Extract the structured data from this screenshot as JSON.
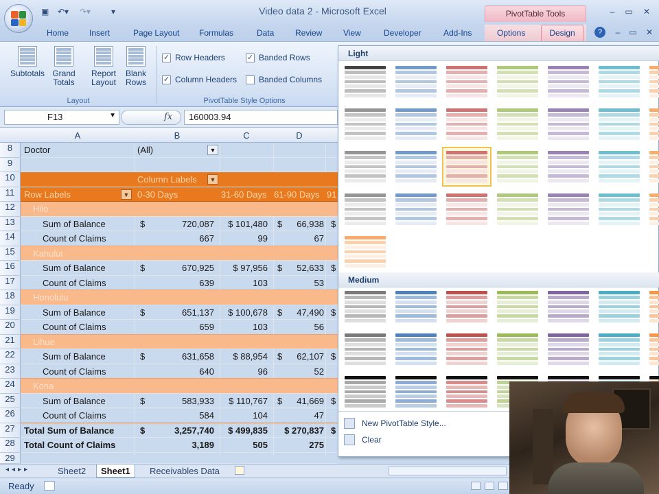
{
  "window": {
    "title": "Video data 2 - Microsoft Excel",
    "contextual_tab_group": "PivotTable Tools"
  },
  "tabs": [
    "Home",
    "Insert",
    "Page Layout",
    "Formulas",
    "Data",
    "Review",
    "View",
    "Developer",
    "Add-Ins",
    "Options",
    "Design"
  ],
  "ribbon": {
    "layout_group": {
      "label": "Layout",
      "buttons": [
        "Subtotals",
        "Grand Totals",
        "Report Layout",
        "Blank Rows"
      ]
    },
    "style_options_group": {
      "label": "PivotTable Style Options",
      "checkboxes": [
        {
          "label": "Row Headers",
          "checked": true
        },
        {
          "label": "Banded Rows",
          "checked": true
        },
        {
          "label": "Column Headers",
          "checked": true
        },
        {
          "label": "Banded Columns",
          "checked": false
        }
      ]
    }
  },
  "formula_bar": {
    "name_box": "F13",
    "fx": "fx",
    "formula": "160003.94"
  },
  "columns": [
    "A",
    "B",
    "C",
    "D"
  ],
  "rows": {
    "r8": {
      "num": "8",
      "a": "Doctor",
      "b": "(All)"
    },
    "r9": {
      "num": "9"
    },
    "r10": {
      "num": "10",
      "b": "Column Labels"
    },
    "r11": {
      "num": "11",
      "a": "Row Labels",
      "b": "0-30 Days",
      "c": "31-60 Days",
      "d": "61-90 Days",
      "e": "91"
    },
    "r12": {
      "num": "12",
      "a": "Hilo"
    },
    "r13": {
      "num": "13",
      "a": "Sum of Balance",
      "b_sym": "$",
      "b": "720,087",
      "c": "$ 101,480",
      "d_sym": "$",
      "d": "66,938",
      "e": "$"
    },
    "r14": {
      "num": "14",
      "a": "Count of Claims",
      "b": "667",
      "c": "99",
      "d": "67"
    },
    "r15": {
      "num": "15",
      "a": "Kahului"
    },
    "r16": {
      "num": "16",
      "a": "Sum of Balance",
      "b_sym": "$",
      "b": "670,925",
      "c": "$ 97,956",
      "d_sym": "$",
      "d": "52,633",
      "e": "$"
    },
    "r17": {
      "num": "17",
      "a": "Count of Claims",
      "b": "639",
      "c": "103",
      "d": "53"
    },
    "r18": {
      "num": "18",
      "a": "Honolulu"
    },
    "r19": {
      "num": "19",
      "a": "Sum of Balance",
      "b_sym": "$",
      "b": "651,137",
      "c": "$ 100,678",
      "d_sym": "$",
      "d": "47,490",
      "e": "$"
    },
    "r20": {
      "num": "20",
      "a": "Count of Claims",
      "b": "659",
      "c": "103",
      "d": "56"
    },
    "r21": {
      "num": "21",
      "a": "Lihue"
    },
    "r22": {
      "num": "22",
      "a": "Sum of Balance",
      "b_sym": "$",
      "b": "631,658",
      "c": "$ 88,954",
      "d_sym": "$",
      "d": "62,107",
      "e": "$"
    },
    "r23": {
      "num": "23",
      "a": "Count of Claims",
      "b": "640",
      "c": "96",
      "d": "52"
    },
    "r24": {
      "num": "24",
      "a": "Kona"
    },
    "r25": {
      "num": "25",
      "a": "Sum of Balance",
      "b_sym": "$",
      "b": "583,933",
      "c": "$ 110,767",
      "d_sym": "$",
      "d": "41,669",
      "e": "$"
    },
    "r26": {
      "num": "26",
      "a": "Count of Claims",
      "b": "584",
      "c": "104",
      "d": "47"
    },
    "r27": {
      "num": "27",
      "a": "Total Sum of Balance",
      "b_sym": "$",
      "b": "3,257,740",
      "c": "$ 499,835",
      "d": "$ 270,837",
      "e": "$"
    },
    "r28": {
      "num": "28",
      "a": "Total Count of Claims",
      "b": "3,189",
      "c": "505",
      "d": "275"
    },
    "r29": {
      "num": "29"
    }
  },
  "sheet_tabs": [
    "Sheet2",
    "Sheet1",
    "Receivables Data"
  ],
  "active_sheet": "Sheet1",
  "status": "Ready",
  "gallery": {
    "light_label": "Light",
    "medium_label": "Medium",
    "menu": [
      "New PivotTable Style...",
      "Clear"
    ],
    "palette": [
      "#7a7a7a",
      "#4f81bd",
      "#c0504d",
      "#9bbb59",
      "#8064a2",
      "#4bacc6",
      "#f79646"
    ]
  },
  "colors": {
    "pivot_header": "#e8791f",
    "pivot_band": "#f9b98a",
    "contextual": "#f2c3cc"
  }
}
